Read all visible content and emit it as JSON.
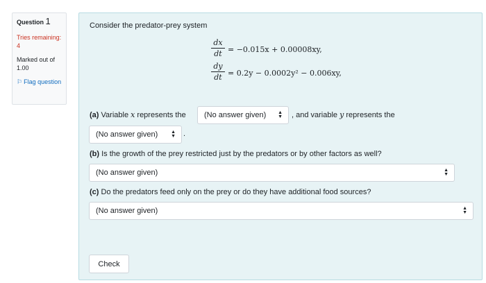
{
  "info": {
    "question_label": "Question",
    "question_number": "1",
    "tries": "Tries remaining: 4",
    "marked": "Marked out of 1.00",
    "flag": "Flag question"
  },
  "question": {
    "intro": "Consider the predator-prey system",
    "eq1": {
      "num": "dx",
      "den": "dt",
      "rhs": "= −0.015x + 0.00008xy,"
    },
    "eq2": {
      "num": "dy",
      "den": "dt",
      "rhs": "= 0.2y − 0.0002y² − 0.006xy,"
    },
    "part_a": {
      "label": "(a)",
      "text1": "Variable",
      "var_x": "x",
      "text2": "represents the",
      "text3": ", and variable",
      "var_y": "y",
      "text4": "represents the",
      "select1": "(No answer given)",
      "select2": "(No answer given)",
      "end": "."
    },
    "part_b": {
      "label": "(b)",
      "text": "Is the growth of the prey restricted just by the predators or by other factors as well?",
      "select": "(No answer given)"
    },
    "part_c": {
      "label": "(c)",
      "text": "Do the predators feed only on the prey or do they have additional food sources?",
      "select": "(No answer given)"
    },
    "check": "Check"
  }
}
